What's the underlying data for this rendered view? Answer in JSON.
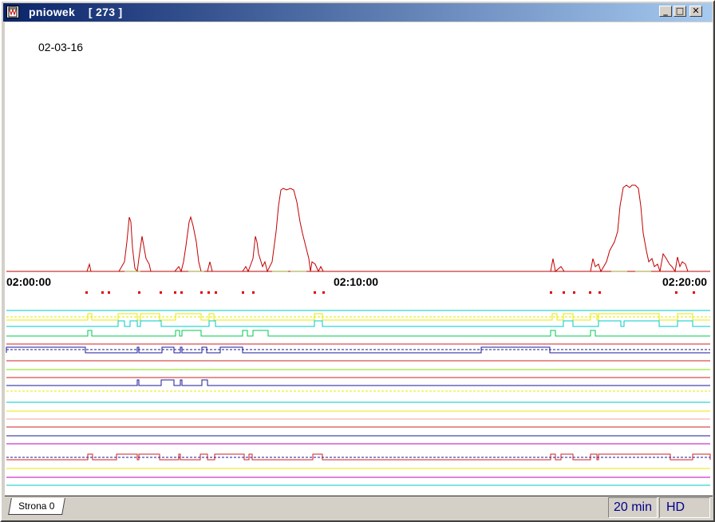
{
  "window": {
    "title": "pniowek    [ 273 ]",
    "minimize_glyph": "_",
    "maximize_glyph": "□",
    "close_glyph": "✕"
  },
  "chart": {
    "date": "02-03-16",
    "time_labels": [
      "02:00:00",
      "02:10:00",
      "02:20:00"
    ],
    "colors": {
      "signal": "#c00000",
      "marker": "#e00000",
      "cyan": "#00c8c8",
      "yellow": "#e8e800",
      "green": "#00c850",
      "navy": "#1a1a9a",
      "red": "#d02020",
      "pink": "#f0a0a0",
      "magenta": "#c000c0",
      "lime": "#80e000"
    }
  },
  "status": {
    "tab_label": "Strona 0",
    "interval": "20 min",
    "mode": "HD"
  }
}
